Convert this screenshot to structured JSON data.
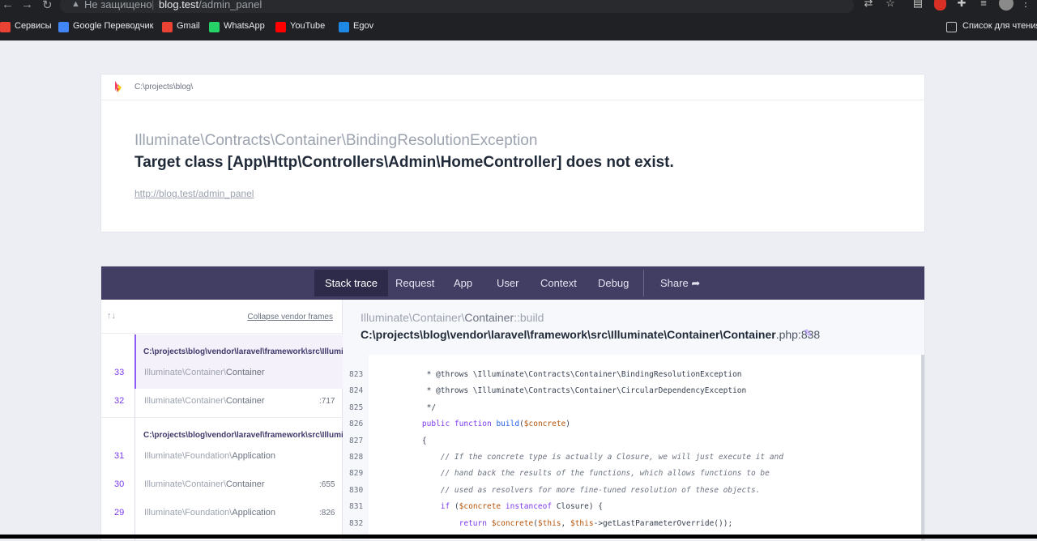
{
  "browser": {
    "security_label": "Не защищено",
    "url_host": "blog.test",
    "url_path": "/admin_panel",
    "bookmarks": [
      {
        "label": "Сервисы",
        "icon": "apps-grid-icon",
        "color": "#ea4335"
      },
      {
        "label": "Google Переводчик",
        "icon": "translate-icon",
        "color": "#4285f4"
      },
      {
        "label": "Gmail",
        "icon": "gmail-icon",
        "color": "#ea4335"
      },
      {
        "label": "WhatsApp",
        "icon": "whatsapp-icon",
        "color": "#25d366"
      },
      {
        "label": "YouTube",
        "icon": "youtube-icon",
        "color": "#ff0000"
      },
      {
        "label": "Egov",
        "icon": "egov-icon",
        "color": "#1e88e5"
      }
    ],
    "reading_list": "Список для чтения"
  },
  "error": {
    "project_path": "C:\\projects\\blog\\",
    "exception_class": "Illuminate\\Contracts\\Container\\BindingResolutionException",
    "message": "Target class [App\\Http\\Controllers\\Admin\\HomeController] does not exist.",
    "url": "http://blog.test/admin_panel"
  },
  "tabs": [
    "Stack trace",
    "Request",
    "App",
    "User",
    "Context",
    "Debug"
  ],
  "share_label": "Share",
  "frames_panel": {
    "collapse_label": "Collapse vendor frames",
    "group_path": "C:\\projects\\blog\\vendor\\laravel\\framework\\src\\Illuminate\\Container\\Container.php",
    "frames": [
      {
        "num": "33",
        "ns": "Illuminate\\Container\\",
        "cls": "Container",
        "line": ""
      },
      {
        "num": "32",
        "ns": "Illuminate\\Container\\",
        "cls": "Container",
        "line": ":717"
      },
      {
        "num": "31",
        "ns": "Illuminate\\Foundation\\",
        "cls": "Application",
        "line": ""
      },
      {
        "num": "30",
        "ns": "Illuminate\\Container\\",
        "cls": "Container",
        "line": ":655"
      },
      {
        "num": "29",
        "ns": "Illuminate\\Foundation\\",
        "cls": "Application",
        "line": ":826"
      }
    ]
  },
  "code": {
    "frame_ns": "Illuminate\\Container\\",
    "frame_cls": "Container",
    "frame_method": "::build",
    "file": "C:\\projects\\blog\\vendor\\laravel\\framework\\src\\Illuminate\\Container\\Container",
    "file_ext": ".php:838",
    "line_numbers": [
      "823",
      "824",
      "825",
      "826",
      "827",
      "828",
      "829",
      "830",
      "831",
      "832"
    ],
    "lines": [
      "     * @throws \\Illuminate\\Contracts\\Container\\BindingResolutionException",
      "     * @throws \\Illuminate\\Contracts\\Container\\CircularDependencyException",
      "     */",
      "    public function build($concrete)",
      "    {",
      "        // If the concrete type is actually a Closure, we will just execute it and",
      "        // hand back the results of the functions, which allows functions to be",
      "        // used as resolvers for more fine-tuned resolution of these objects.",
      "        if ($concrete instanceof Closure) {",
      "            return $concrete($this, $this->getLastParameterOverride());"
    ]
  }
}
